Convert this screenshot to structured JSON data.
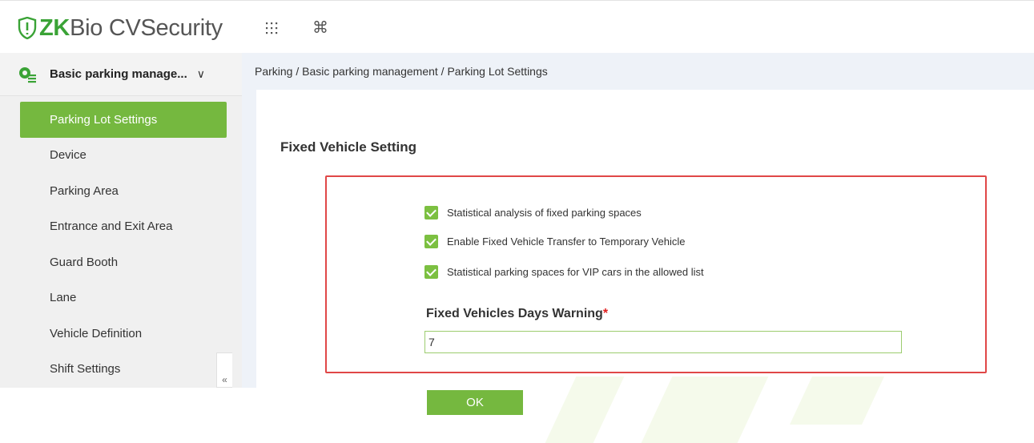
{
  "header": {
    "logo_zk": "ZK",
    "logo_rest": "Bio CVSecurity",
    "apps_icon": "grid-icon",
    "command_icon": "command-icon",
    "command_glyph": "⌘"
  },
  "sidebar": {
    "module_label": "Basic parking manage...",
    "module_icon": "parking-module-icon",
    "chevron": "∨",
    "items": [
      {
        "label": "Parking Lot Settings",
        "active": true
      },
      {
        "label": "Device"
      },
      {
        "label": "Parking Area"
      },
      {
        "label": "Entrance and Exit Area"
      },
      {
        "label": "Guard Booth"
      },
      {
        "label": "Lane"
      },
      {
        "label": "Vehicle Definition"
      },
      {
        "label": "Shift Settings"
      }
    ],
    "collapse_label": "«"
  },
  "breadcrumb": "Parking / Basic parking management / Parking Lot Settings",
  "main": {
    "section_title": "Fixed Vehicle Setting",
    "checkboxes": [
      {
        "label": "Statistical analysis of fixed parking spaces",
        "checked": true
      },
      {
        "label": "Enable Fixed Vehicle Transfer to Temporary Vehicle",
        "checked": true
      },
      {
        "label": "Statistical parking spaces for VIP cars in the allowed list",
        "checked": true
      }
    ],
    "days_warning_label": "Fixed Vehicles Days Warning",
    "required_mark": "*",
    "days_warning_value": "7",
    "ok_label": "OK"
  },
  "colors": {
    "accent": "#75b83f",
    "highlight_border": "#e04747"
  }
}
